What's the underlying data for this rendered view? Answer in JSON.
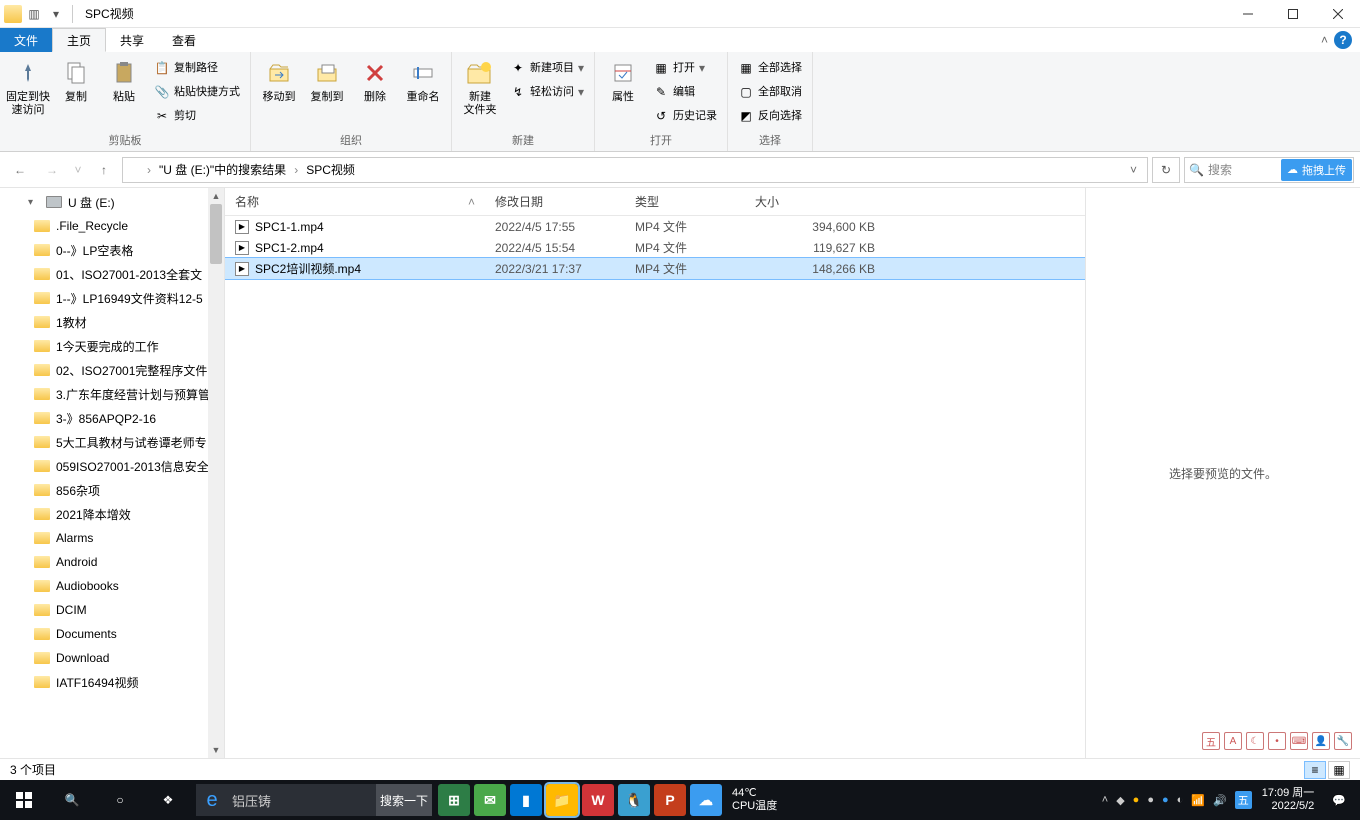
{
  "title": "SPC视频",
  "tabs": {
    "file": "文件",
    "home": "主页",
    "share": "共享",
    "view": "查看"
  },
  "ribbon": {
    "pin": "固定到快\n速访问",
    "copy": "复制",
    "paste": "粘贴",
    "copy_path": "复制路径",
    "paste_shortcut": "粘贴快捷方式",
    "cut": "剪切",
    "clipboard": "剪贴板",
    "moveto": "移动到",
    "copyto": "复制到",
    "delete": "删除",
    "rename": "重命名",
    "organize": "组织",
    "new_folder": "新建\n文件夹",
    "new_item": "新建项目",
    "easy_access": "轻松访问",
    "new": "新建",
    "properties": "属性",
    "open": "打开",
    "edit": "编辑",
    "history": "历史记录",
    "open_group": "打开",
    "select_all": "全部选择",
    "select_none": "全部取消",
    "invert": "反向选择",
    "select": "选择"
  },
  "breadcrumb": {
    "b1": "\"U 盘 (E:)\"中的搜索结果",
    "b2": "SPC视频"
  },
  "search_placeholder": "搜索",
  "upload_badge": "拖拽上传",
  "columns": {
    "name": "名称",
    "date": "修改日期",
    "type": "类型",
    "size": "大小"
  },
  "files": [
    {
      "name": "SPC1-1.mp4",
      "date": "2022/4/5 17:55",
      "type": "MP4 文件",
      "size": "394,600 KB"
    },
    {
      "name": "SPC1-2.mp4",
      "date": "2022/4/5 15:54",
      "type": "MP4 文件",
      "size": "119,627 KB"
    },
    {
      "name": "SPC2培训视频.mp4",
      "date": "2022/3/21 17:37",
      "type": "MP4 文件",
      "size": "148,266 KB"
    }
  ],
  "tree": {
    "drive": "U 盘 (E:)",
    "items": [
      ".File_Recycle",
      "0--》LP空表格",
      "01、ISO27001-2013全套文",
      "1--》LP16949文件资料12-5",
      "1教材",
      "1今天要完成的工作",
      "02、ISO27001完整程序文件",
      "3.广东年度经营计划与预算管",
      "3-》856APQP2-16",
      "5大工具教材与试卷谭老师专",
      "059ISO27001-2013信息安全",
      "856杂项",
      "2021降本增效",
      "Alarms",
      "Android",
      "Audiobooks",
      "DCIM",
      "Documents",
      "Download",
      "IATF16494视频"
    ]
  },
  "preview_msg": "选择要预览的文件。",
  "status": "3 个项目",
  "taskbar": {
    "search_text": "铝压铸",
    "search_go": "搜索一下",
    "temp1": "44℃",
    "temp2": "CPU温度",
    "time": "17:09 周一",
    "date": "2022/5/2"
  }
}
